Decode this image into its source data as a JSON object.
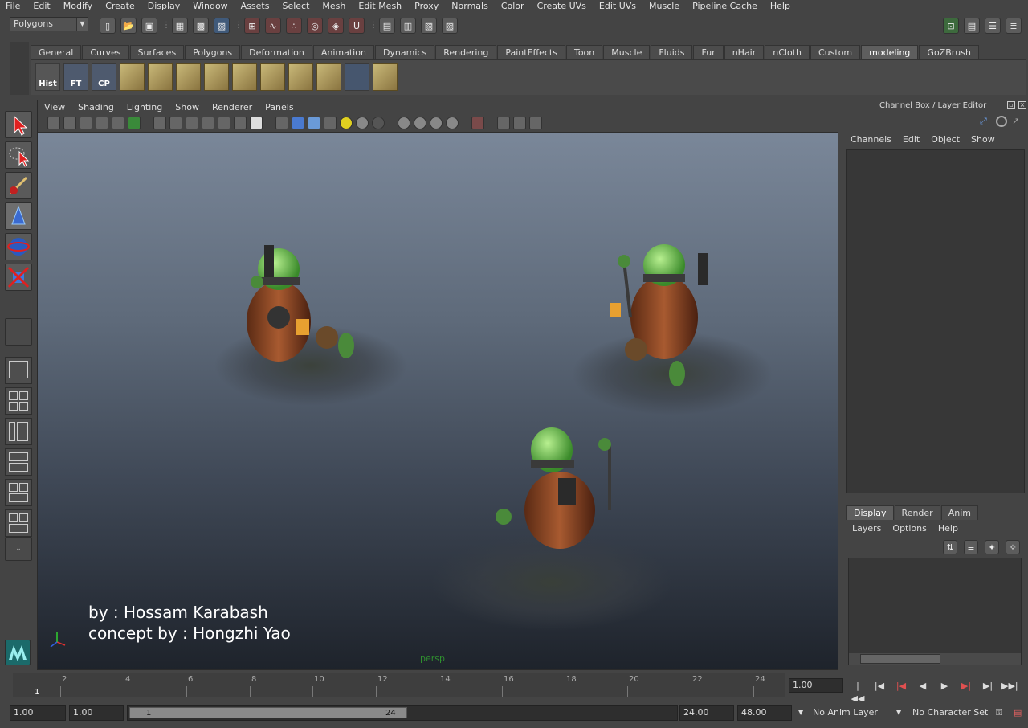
{
  "menubar": [
    "File",
    "Edit",
    "Modify",
    "Create",
    "Display",
    "Window",
    "Assets",
    "Select",
    "Mesh",
    "Edit Mesh",
    "Proxy",
    "Normals",
    "Color",
    "Create UVs",
    "Edit UVs",
    "Muscle",
    "Pipeline Cache",
    "Help"
  ],
  "status_line": {
    "mode": "Polygons"
  },
  "shelf": {
    "tabs": [
      "General",
      "Curves",
      "Surfaces",
      "Polygons",
      "Deformation",
      "Animation",
      "Dynamics",
      "Rendering",
      "PaintEffects",
      "Toon",
      "Muscle",
      "Fluids",
      "Fur",
      "nHair",
      "nCloth",
      "Custom",
      "modeling",
      "GoZBrush"
    ],
    "active_tab": "modeling",
    "buttons": [
      "Hist",
      "FT",
      "CP"
    ]
  },
  "viewport": {
    "menu": [
      "View",
      "Shading",
      "Lighting",
      "Show",
      "Renderer",
      "Panels"
    ],
    "credit_line1": "by : Hossam Karabash",
    "credit_line2": "concept by : Hongzhi Yao",
    "camera": "persp"
  },
  "channel_box": {
    "title": "Channel Box / Layer Editor",
    "menu": [
      "Channels",
      "Edit",
      "Object",
      "Show"
    ]
  },
  "layer_editor": {
    "tabs": [
      "Display",
      "Render",
      "Anim"
    ],
    "active_tab": "Display",
    "menu": [
      "Layers",
      "Options",
      "Help"
    ]
  },
  "time_slider": {
    "ticks": [
      2,
      4,
      6,
      8,
      10,
      12,
      14,
      16,
      18,
      20,
      22,
      24
    ],
    "current_frame": "1",
    "current_time_field": "1.00"
  },
  "range_slider": {
    "start_time": "1.00",
    "playback_start": "1.00",
    "range_start_label": "1",
    "range_end_label": "24",
    "playback_end": "24.00",
    "end_time": "48.00",
    "anim_layer": "No Anim Layer",
    "character_set": "No Character Set"
  }
}
